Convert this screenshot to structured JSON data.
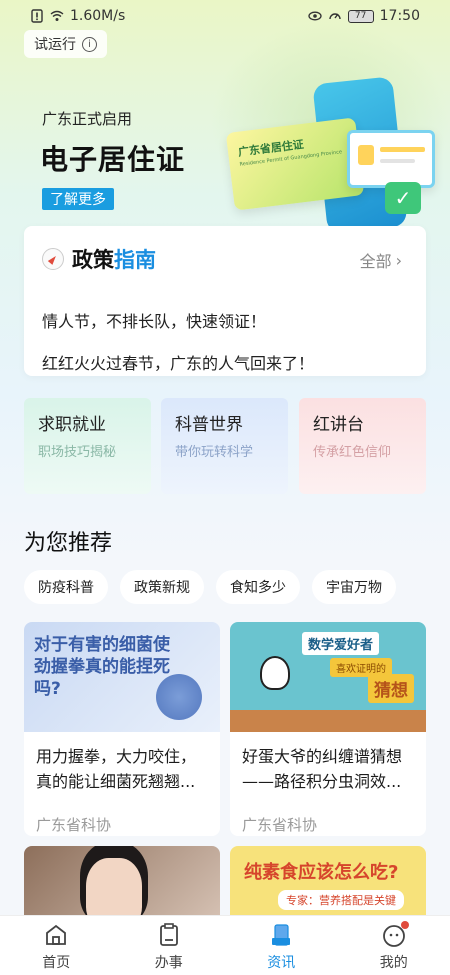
{
  "status_bar": {
    "speed": "1.60M/s",
    "battery": "77",
    "time": "17:50"
  },
  "trial": {
    "label": "试运行"
  },
  "hero": {
    "subtitle": "广东正式启用",
    "title": "电子居住证",
    "cta": "了解更多",
    "card_title": "广东省居住证",
    "card_subtitle": "Residence Permit of Guangdong Province"
  },
  "policy": {
    "title_main": "政策",
    "title_accent": "指南",
    "all_label": "全部",
    "items": [
      "情人节，不排长队，快速领证！",
      "红红火火过春节，广东的人气回来了！"
    ]
  },
  "tiles": [
    {
      "title": "求职就业",
      "subtitle": "职场技巧揭秘"
    },
    {
      "title": "科普世界",
      "subtitle": "带你玩转科学"
    },
    {
      "title": "红讲台",
      "subtitle": "传承红色信仰"
    }
  ],
  "recommend": {
    "title": "为您推荐",
    "chips": [
      "防疫科普",
      "政策新规",
      "食知多少",
      "宇宙万物"
    ]
  },
  "articles": [
    {
      "image_text": "对于有害的细菌使劲握拳真的能捏死吗?",
      "title": "用力握拳，大力咬住，真的能让细菌死翘翘...",
      "source": "广东省科协"
    },
    {
      "image_banner1": "数学爱好者",
      "image_banner2": "喜欢证明的",
      "image_banner3": "猜想",
      "title": "好蛋大爷的纠缠谱猜想——路径积分虫洞效...",
      "source": "广东省科协"
    }
  ],
  "article_4": {
    "line1": "纯素食应该怎么吃?",
    "line2": "专家：营养搭配是关键"
  },
  "nav": {
    "items": [
      "首页",
      "办事",
      "资讯",
      "我的"
    ],
    "active": "资讯"
  },
  "colors": {
    "accent": "#1a8ee0",
    "cta": "#1a9de0",
    "badge": "#e04b3c"
  }
}
